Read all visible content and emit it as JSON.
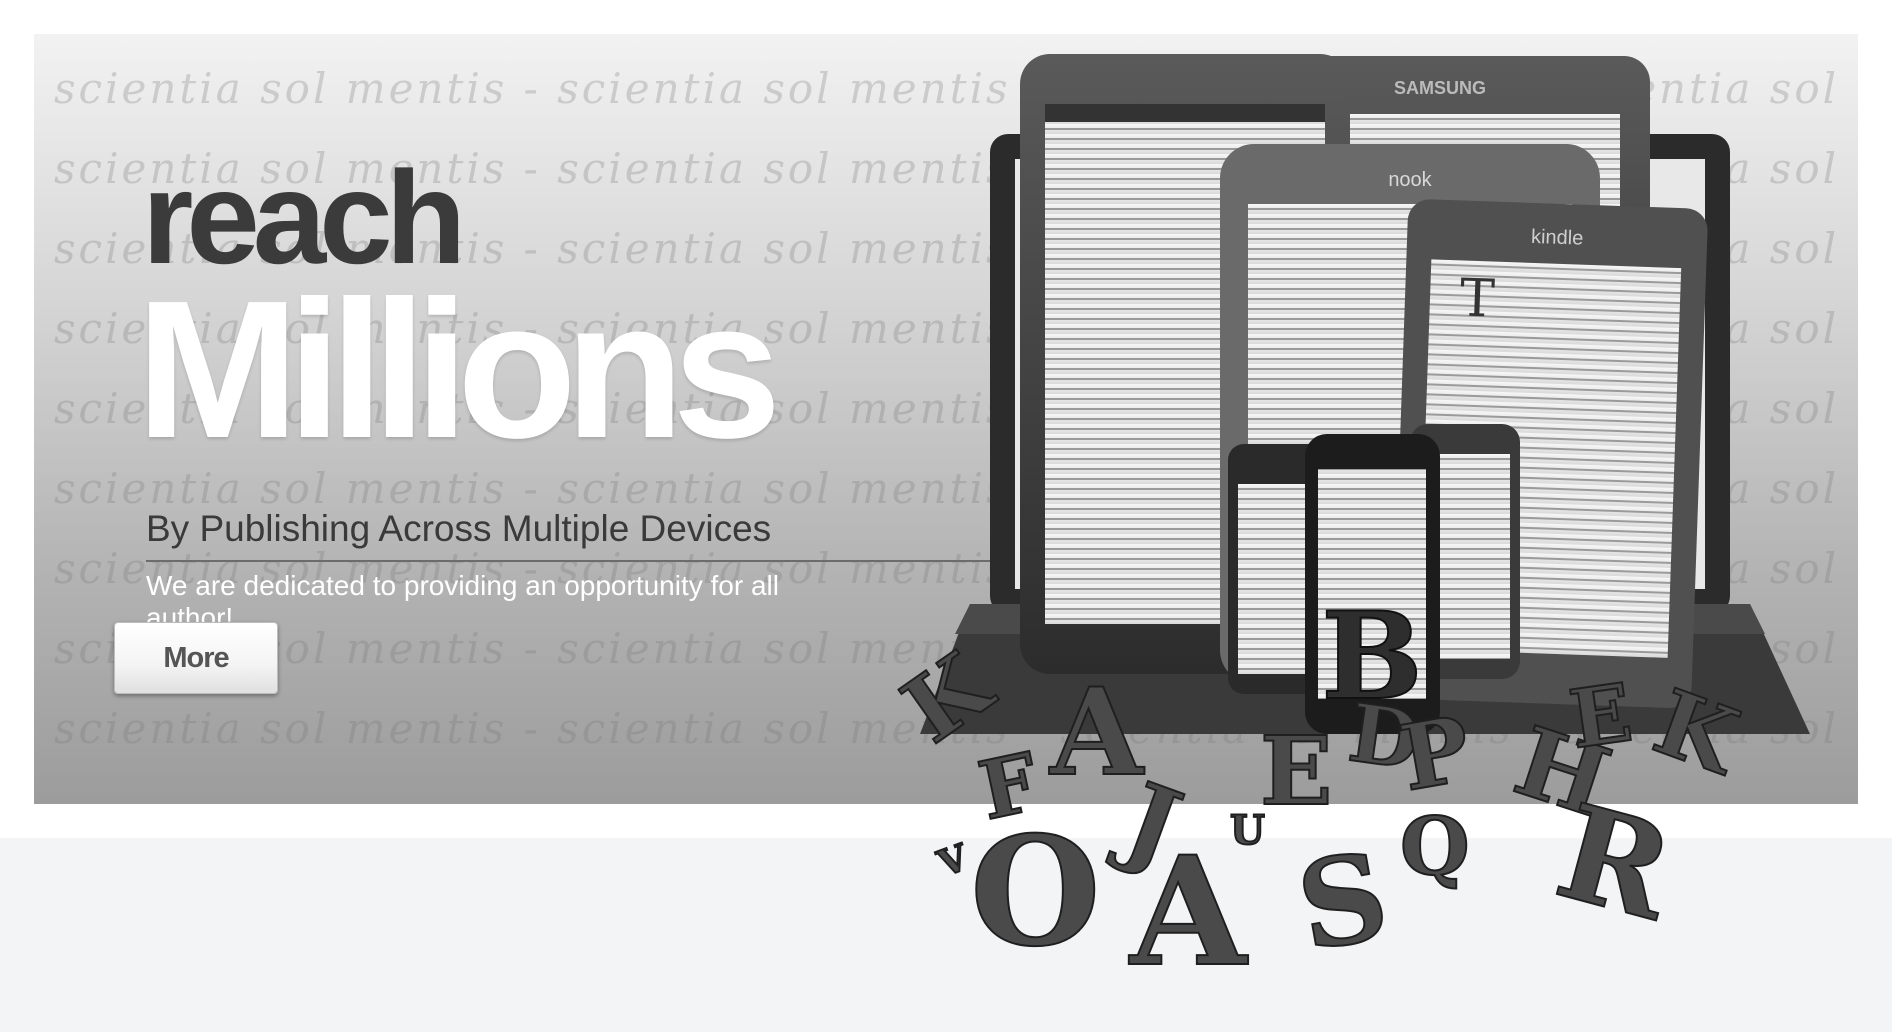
{
  "hero": {
    "watermark_text": "scientia sol mentis - scientia sol mentis - scientia sol mentis - scientia sol mentis - scientia sol mentis",
    "headline_small": "reach",
    "headline_large": "Millions",
    "subtitle": "By Publishing Across Multiple Devices",
    "description": "We are dedicated to providing an opportunity for all author!",
    "more_label": "More"
  },
  "devices": {
    "samsung_brand": "SAMSUNG",
    "nook_brand": "nook",
    "kindle_brand": "kindle",
    "big_letter": "B",
    "letters": [
      "K",
      "A",
      "F",
      "E",
      "D",
      "P",
      "H",
      "E",
      "K",
      "J",
      "U",
      "O",
      "A",
      "S",
      "Q",
      "R",
      "V"
    ]
  },
  "colors": {
    "headline_dark": "#3b3b3b",
    "headline_light": "#ffffff",
    "page_band": "#f3f4f6"
  }
}
